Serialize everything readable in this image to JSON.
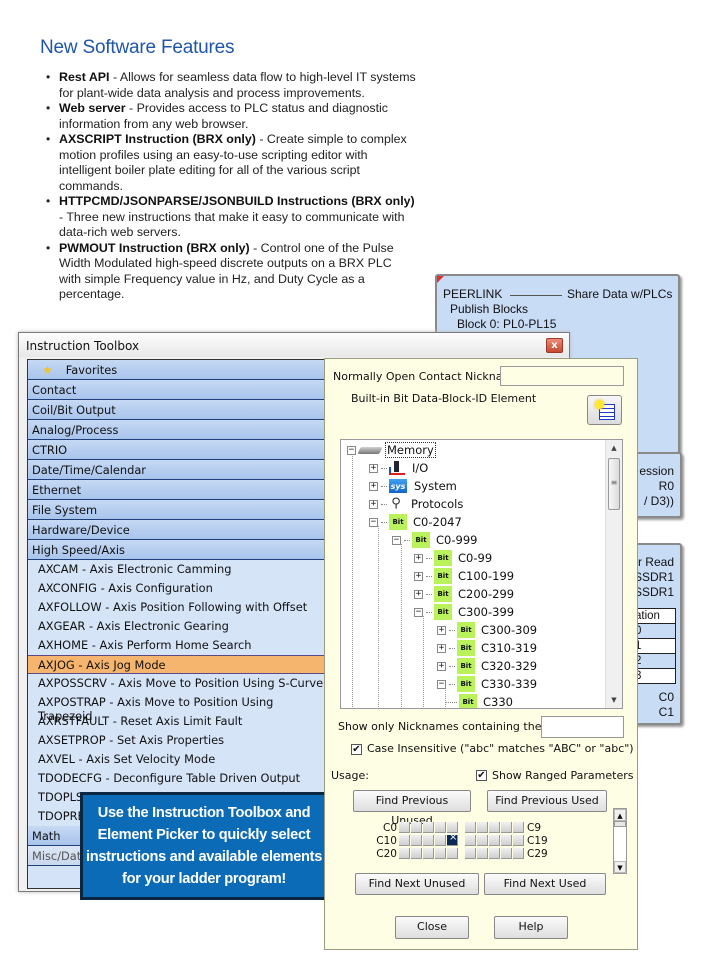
{
  "article": {
    "headline": "New Software Features",
    "features": [
      {
        "title": "Rest API",
        "text": " - Allows for seamless data flow to high-level IT systems for plant-wide data analysis and process improvements."
      },
      {
        "title": "Web server",
        "text": " - Provides access to PLC status and diagnostic information from any web browser."
      },
      {
        "title": "AXSCRIPT Instruction (BRX only)",
        "text": "  - Create simple to complex motion profiles using an easy-to-use scripting editor with intelligent boiler plate editing for all of the various script commands."
      },
      {
        "title": "HTTPCMD/JSONPARSE/JSONBUILD Instructions (BRX only)",
        "text": " -  Three new instructions that make it easy to communicate with data-rich web servers."
      },
      {
        "title": "PWMOUT Instruction (BRX only)",
        "text": " - Control one of the Pulse Width Modulated high-speed discrete outputs on a BRX PLC with simple Frequency value in Hz, and Duty Cycle as a percentage."
      }
    ]
  },
  "ladder": {
    "peerlink": {
      "name": "PEERLINK",
      "desc": "Share Data w/PLCs",
      "line2": "Publish Blocks",
      "line3": "Block 0: PL0-PL15"
    },
    "expression": {
      "line1": "ession",
      "line2": "R0",
      "line3": "/ D3))"
    },
    "read": {
      "line1": "r Read",
      "line2": "SSDR1",
      "line3": "SSDR1",
      "table_header": "ation",
      "rows": [
        "0",
        "1",
        "2",
        "3"
      ],
      "bottom1": "C0",
      "bottom2": "C1"
    }
  },
  "toolbox": {
    "title": "Instruction Toolbox",
    "close_glyph": "x",
    "favorites": "Favorites",
    "categories": [
      "Contact",
      "Coil/Bit Output",
      "Analog/Process",
      "CTRIO",
      "Date/Time/Calendar",
      "Ethernet",
      "File System",
      "Hardware/Device",
      "High Speed/Axis"
    ],
    "items": [
      "AXCAM - Axis Electronic Camming",
      "AXCONFIG - Axis Configuration",
      "AXFOLLOW - Axis Position Following with Offset",
      "AXGEAR - Axis Electronic Gearing",
      "AXHOME - Axis Perform Home Search",
      "AXJOG - Axis Jog Mode",
      "AXPOSSCRV - Axis Move to Position Using S-Curve",
      "AXPOSTRAP - Axis Move to Position Using Trapezoid",
      "AXRSTFAULT - Reset Axis Limit Fault",
      "AXSETPROP - Set Axis Properties",
      "AXVEL - Axis Set Velocity Mode",
      "TDODECFG - Deconfigure Table Driven Output",
      "TDOPLS",
      "TDOPRE"
    ],
    "selected_item": "AXJOG - Axis Jog Mode",
    "after_categories": [
      "Math",
      "Misc/Dat"
    ]
  },
  "callout": {
    "text": "Use the Instruction Toolbox and Element Picker to quickly select instructions and available elements for your ladder program!"
  },
  "picker": {
    "nickname_label": "Normally Open Contact Nickname",
    "nickname_value": "",
    "builtin_label": "Built-in Bit Data-Block-ID Element",
    "tree": [
      {
        "label": "Memory",
        "icon": "memory-icon",
        "level": 0,
        "state": "expanded"
      },
      {
        "label": "I/O",
        "icon": "io-icon",
        "level": 1,
        "state": "collapsed"
      },
      {
        "label": "System",
        "icon": "system-icon",
        "level": 1,
        "state": "collapsed"
      },
      {
        "label": "Protocols",
        "icon": "protocols-icon",
        "level": 1,
        "state": "collapsed"
      },
      {
        "label": "C0-2047",
        "icon": "bit-icon",
        "level": 1,
        "state": "expanded"
      },
      {
        "label": "C0-999",
        "icon": "bit-icon",
        "level": 2,
        "state": "expanded"
      },
      {
        "label": "C0-99",
        "icon": "bit-icon",
        "level": 3,
        "state": "collapsed"
      },
      {
        "label": "C100-199",
        "icon": "bit-icon",
        "level": 3,
        "state": "collapsed"
      },
      {
        "label": "C200-299",
        "icon": "bit-icon",
        "level": 3,
        "state": "collapsed"
      },
      {
        "label": "C300-399",
        "icon": "bit-icon",
        "level": 3,
        "state": "expanded"
      },
      {
        "label": "C300-309",
        "icon": "bit-icon",
        "level": 4,
        "state": "collapsed"
      },
      {
        "label": "C310-319",
        "icon": "bit-icon",
        "level": 4,
        "state": "collapsed"
      },
      {
        "label": "C320-329",
        "icon": "bit-icon",
        "level": 4,
        "state": "collapsed"
      },
      {
        "label": "C330-339",
        "icon": "bit-icon",
        "level": 4,
        "state": "expanded"
      },
      {
        "label": "C330",
        "icon": "bit-icon",
        "level": 5,
        "state": "leaf"
      }
    ],
    "bit_badge": "Bit",
    "show_only_label": "Show only Nicknames containing the text",
    "show_only_value": "",
    "case_insensitive_label": "Case Insensitive (\"abc\" matches \"ABC\" or \"abc\")",
    "case_insensitive_checked": true,
    "usage_label": "Usage:",
    "show_ranged_label": "Show Ranged Parameters",
    "show_ranged_checked": true,
    "buttons": {
      "find_prev_unused": "Find Previous Unused",
      "find_prev_used": "Find Previous Used",
      "find_next_unused": "Find Next Unused",
      "find_next_used": "Find Next Used",
      "close": "Close",
      "help": "Help"
    },
    "usage_rows": [
      {
        "left": "C0",
        "right": "C9",
        "used": []
      },
      {
        "left": "C10",
        "right": "C19",
        "used": [
          4
        ]
      },
      {
        "left": "C20",
        "right": "C29",
        "used": []
      }
    ],
    "check_glyph": "✔"
  }
}
